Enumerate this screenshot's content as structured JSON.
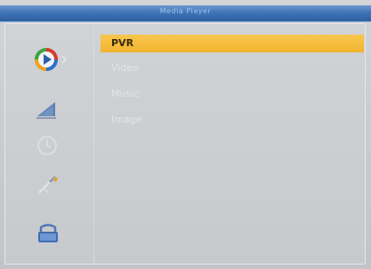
{
  "header": {
    "title": "Media Player"
  },
  "menu": {
    "items": [
      {
        "label": "PVR",
        "selected": true
      },
      {
        "label": "Video",
        "selected": false
      },
      {
        "label": "Music",
        "selected": false
      },
      {
        "label": "Image",
        "selected": false
      }
    ]
  },
  "sidebar": {
    "icons": [
      "media-player-icon",
      "signal-icon",
      "time-icon",
      "tools-icon",
      "game-icon"
    ],
    "active": "media-player-icon"
  },
  "colors": {
    "title_bar": "#3f74b8",
    "selection": "#f2b431",
    "background": "#c9cbcf"
  }
}
